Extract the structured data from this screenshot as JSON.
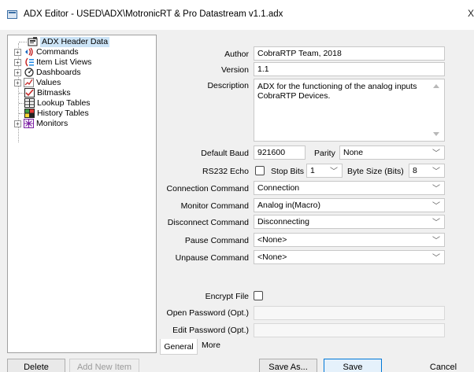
{
  "window": {
    "title": "ADX Editor - USED\\ADX\\MotronicRT & Pro Datastream v1.1.adx",
    "close_glyph": "X"
  },
  "tree": {
    "items": [
      {
        "label": "ADX Header Data",
        "icon": "header-data-icon",
        "expandable": false
      },
      {
        "label": "Commands",
        "icon": "commands-icon",
        "expandable": true
      },
      {
        "label": "Item List Views",
        "icon": "item-list-views-icon",
        "expandable": true
      },
      {
        "label": "Dashboards",
        "icon": "dashboards-icon",
        "expandable": true
      },
      {
        "label": "Values",
        "icon": "values-icon",
        "expandable": true
      },
      {
        "label": "Bitmasks",
        "icon": "bitmasks-icon",
        "expandable": false
      },
      {
        "label": "Lookup Tables",
        "icon": "lookup-tables-icon",
        "expandable": false
      },
      {
        "label": "History Tables",
        "icon": "history-tables-icon",
        "expandable": false
      },
      {
        "label": "Monitors",
        "icon": "monitors-icon",
        "expandable": true
      }
    ]
  },
  "form": {
    "author_label": "Author",
    "author_value": "CobraRTP Team, 2018",
    "version_label": "Version",
    "version_value": "1.1",
    "description_label": "Description",
    "description_value": "ADX for the functioning of the analog inputs CobraRTP Devices.",
    "baud_label": "Default Baud",
    "baud_value": "921600",
    "parity_label": "Parity",
    "parity_value": "None",
    "rs232_label": "RS232 Echo",
    "stopbits_label": "Stop Bits",
    "stopbits_value": "1",
    "bytesize_label": "Byte Size (Bits)",
    "bytesize_value": "8",
    "connection_label": "Connection Command",
    "connection_value": "Connection",
    "monitor_label": "Monitor Command",
    "monitor_value": "Analog in(Macro)",
    "disconnect_label": "Disconnect Command",
    "disconnect_value": "Disconnecting",
    "pause_label": "Pause Command",
    "pause_value": "<None>",
    "unpause_label": "Unpause Command",
    "unpause_value": "<None>",
    "encrypt_label": "Encrypt File",
    "open_pw_label": "Open Password (Opt.)",
    "open_pw_value": "",
    "edit_pw_label": "Edit Password (Opt.)",
    "edit_pw_value": ""
  },
  "tabs": [
    {
      "label": "General",
      "active": true
    },
    {
      "label": "More",
      "active": false
    }
  ],
  "buttons": {
    "delete": "Delete",
    "add_new_item": "Add New Item",
    "save_as": "Save As...",
    "save": "Save",
    "cancel": "Cancel"
  }
}
